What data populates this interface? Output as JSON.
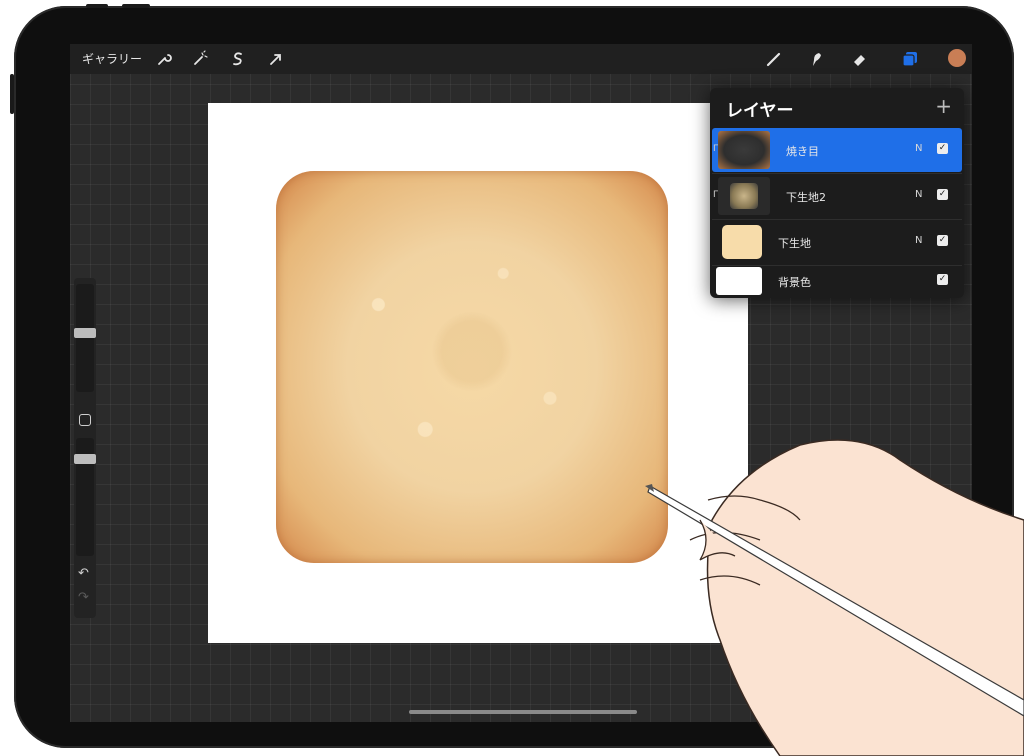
{
  "toolbar": {
    "gallery_label": "ギャラリー",
    "left_icons": [
      "wrench-icon",
      "magic-wand-icon",
      "selection-s-icon",
      "transform-arrow-icon"
    ],
    "right_icons": [
      "brush-icon",
      "smudge-icon",
      "eraser-icon",
      "layers-icon",
      "color-swatch"
    ],
    "active_color": "#c97e55",
    "active_tool_color": "#1f6fe8"
  },
  "layers_panel": {
    "title": "レイヤー",
    "add_label": "+",
    "layers": [
      {
        "name": "焼き目",
        "blend": "N",
        "visible": true,
        "selected": true,
        "clipped": true
      },
      {
        "name": "下生地2",
        "blend": "N",
        "visible": true,
        "selected": false,
        "clipped": true
      },
      {
        "name": "下生地",
        "blend": "N",
        "visible": true,
        "selected": false,
        "clipped": false
      },
      {
        "name": "背景色",
        "blend": "",
        "visible": true,
        "selected": false,
        "clipped": false
      }
    ]
  },
  "sidebar": {
    "brush_size_level": 0.55,
    "opacity_level": 0.85
  },
  "colors": {
    "toast_crust": "#d4874a",
    "toast_center": "#f6d9a6",
    "canvas_bg": "#ffffff"
  }
}
